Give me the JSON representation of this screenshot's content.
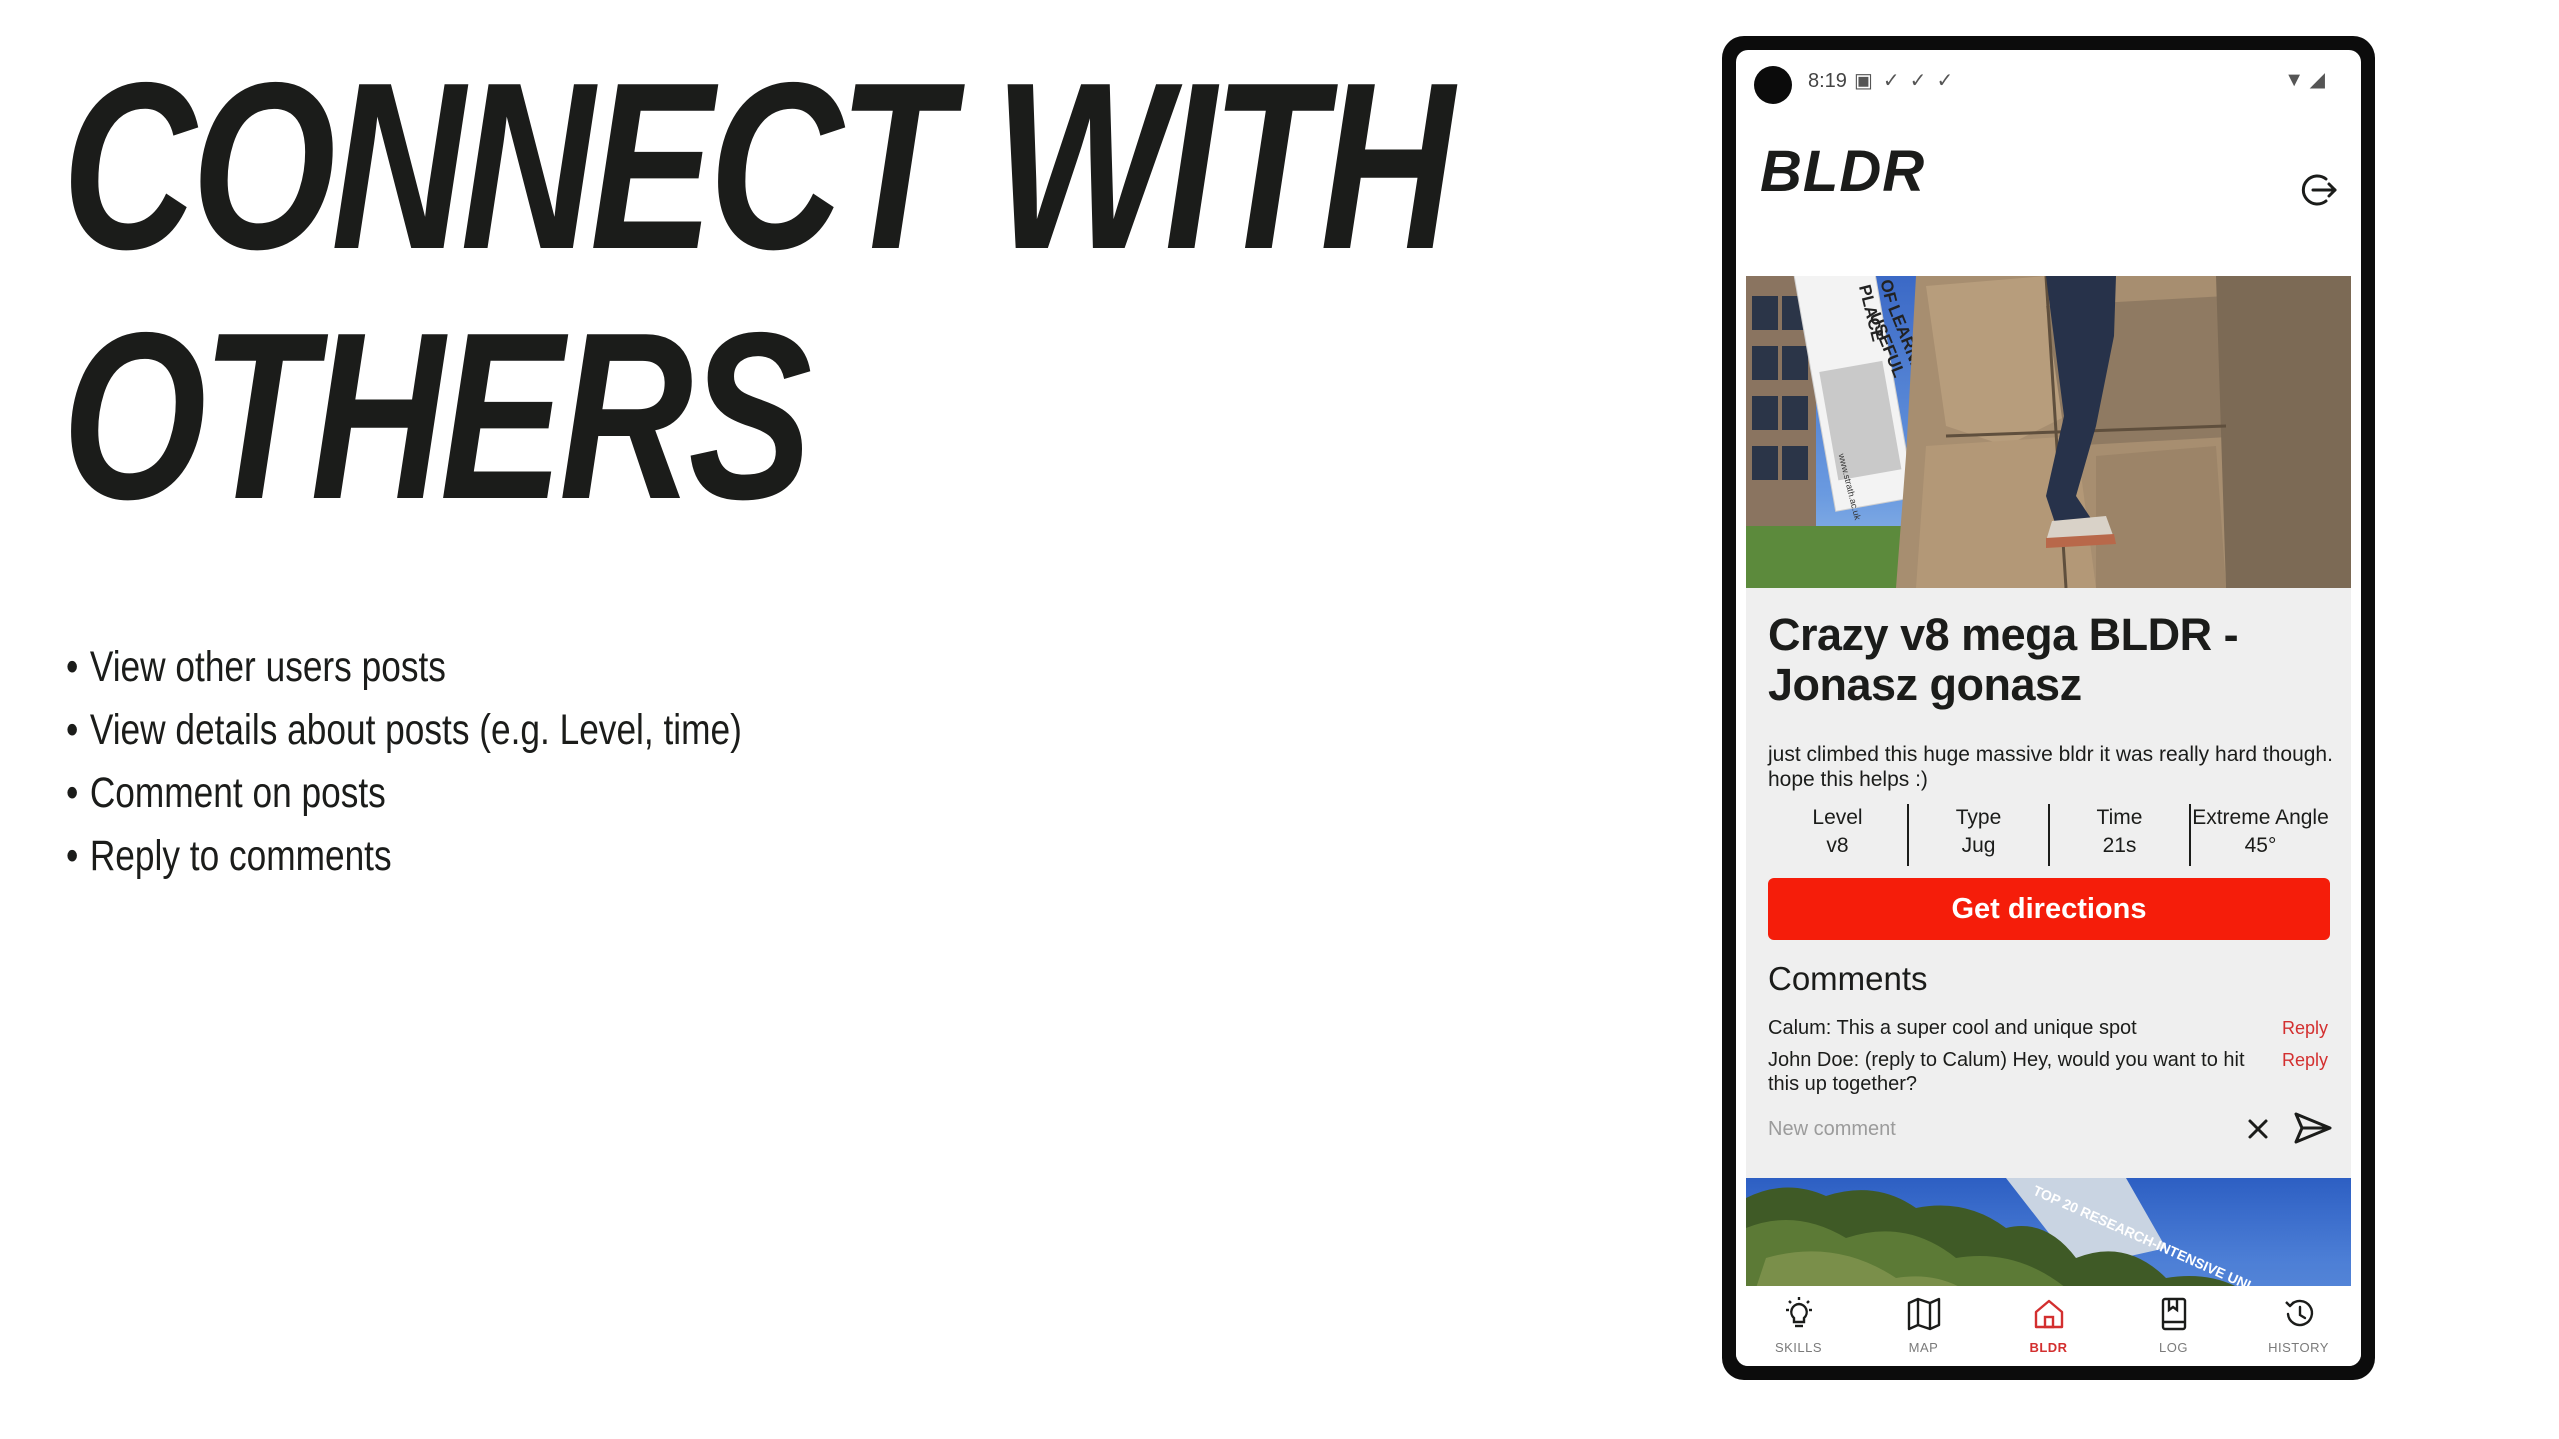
{
  "slide": {
    "title_line1": "CONNECT WITH",
    "title_line2": "OTHERS",
    "bullets": [
      "View other users posts",
      "View details about posts (e.g. Level, time)",
      "Comment on posts",
      "Reply to comments"
    ]
  },
  "status_bar": {
    "time": "8:19",
    "notification_icons": [
      "a-icon",
      "check-icon",
      "check-icon",
      "check-icon"
    ],
    "system_icons": [
      "wifi-icon",
      "signal-icon"
    ]
  },
  "app": {
    "name": "BLDR",
    "logout_icon": "logout-icon",
    "accent_color": "#f51d0a"
  },
  "post": {
    "image_text": [
      "PLACE",
      "OF",
      "USEFUL",
      "LEARNING",
      "www.strath.ac.uk"
    ],
    "title": "Crazy v8 mega BLDR - Jonasz gonasz",
    "description": "just climbed this huge massive bldr it was really hard though. hope this helps :)",
    "stats": [
      {
        "label": "Level",
        "value": "v8"
      },
      {
        "label": "Type",
        "value": "Jug"
      },
      {
        "label": "Time",
        "value": "21s"
      },
      {
        "label": "Extreme Angle",
        "value": "45°"
      }
    ],
    "directions_label": "Get directions",
    "comments_heading": "Comments",
    "comments": [
      {
        "text": "Calum: This a super cool and unique spot",
        "reply_label": "Reply"
      },
      {
        "text": "John Doe: (reply to Calum) Hey, would you want to hit this up together?",
        "reply_label": "Reply"
      }
    ],
    "new_comment_placeholder": "New comment"
  },
  "next_post": {
    "image_text": "TOP 20 RESEARCH-INTENSIVE UNI"
  },
  "nav": {
    "items": [
      {
        "label": "SKILLS",
        "icon": "lightbulb-icon",
        "active": false
      },
      {
        "label": "MAP",
        "icon": "map-icon",
        "active": false
      },
      {
        "label": "BLDR",
        "icon": "home-icon",
        "active": true
      },
      {
        "label": "LOG",
        "icon": "book-icon",
        "active": false
      },
      {
        "label": "HISTORY",
        "icon": "history-icon",
        "active": false
      }
    ]
  }
}
